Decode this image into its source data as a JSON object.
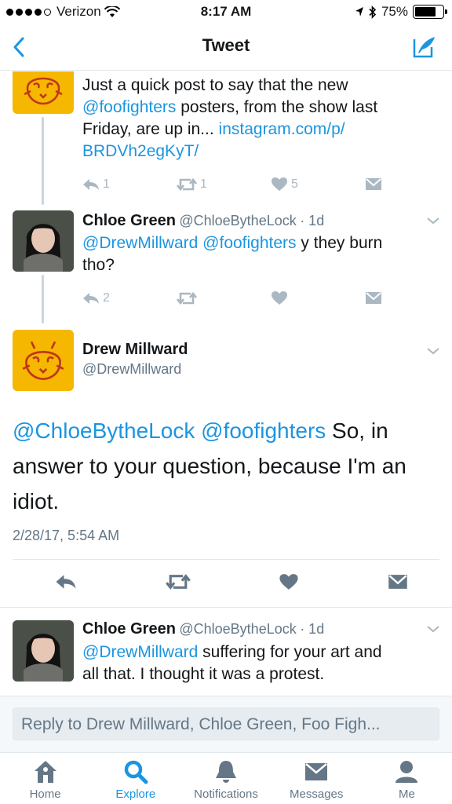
{
  "status_bar": {
    "carrier": "Verizon",
    "time": "8:17 AM",
    "battery": "75%",
    "battery_level": 0.75
  },
  "nav": {
    "title": "Tweet"
  },
  "tweets": [
    {
      "text_plain_1": "Just a quick post to say that the new",
      "mention": "@foofighters",
      "text_plain_2": " posters, from the show last",
      "text_plain_3": "Friday, are up in... ",
      "link_1": "instagram.com/p/",
      "link_2": "BRDVh2egKyT/",
      "reply_count": "1",
      "retweet_count": "1",
      "like_count": "5"
    },
    {
      "name": "Chloe Green",
      "handle": "@ChloeBytheLock",
      "age": "· 1d",
      "mention_1": "@DrewMillward",
      "mention_2": "@foofighters",
      "text_1": " y they burn",
      "text_2": "tho?",
      "reply_count": "2"
    }
  ],
  "main_tweet": {
    "name": "Drew Millward",
    "handle": "@DrewMillward",
    "mention_1": "@ChloeBytheLock",
    "mention_2": "@foofighters",
    "text_1": " So, in",
    "text_2": "answer to your question, because I'm an",
    "text_3": "idiot.",
    "timestamp": "2/28/17, 5:54 AM"
  },
  "reply_tweet": {
    "name": "Chloe Green",
    "handle": "@ChloeBytheLock",
    "age": "· 1d",
    "mention": "@DrewMillward",
    "text_1": " suffering for your art and",
    "text_2": "all that. I thought it was a protest."
  },
  "reply_box": {
    "placeholder": "Reply to Drew Millward, Chloe Green, Foo Figh..."
  },
  "tabs": [
    {
      "label": "Home"
    },
    {
      "label": "Explore"
    },
    {
      "label": "Notifications"
    },
    {
      "label": "Messages"
    },
    {
      "label": "Me"
    }
  ],
  "colors": {
    "accent": "#1b95e0",
    "muted": "#aab8c2",
    "logo_bg": "#f5b700"
  }
}
